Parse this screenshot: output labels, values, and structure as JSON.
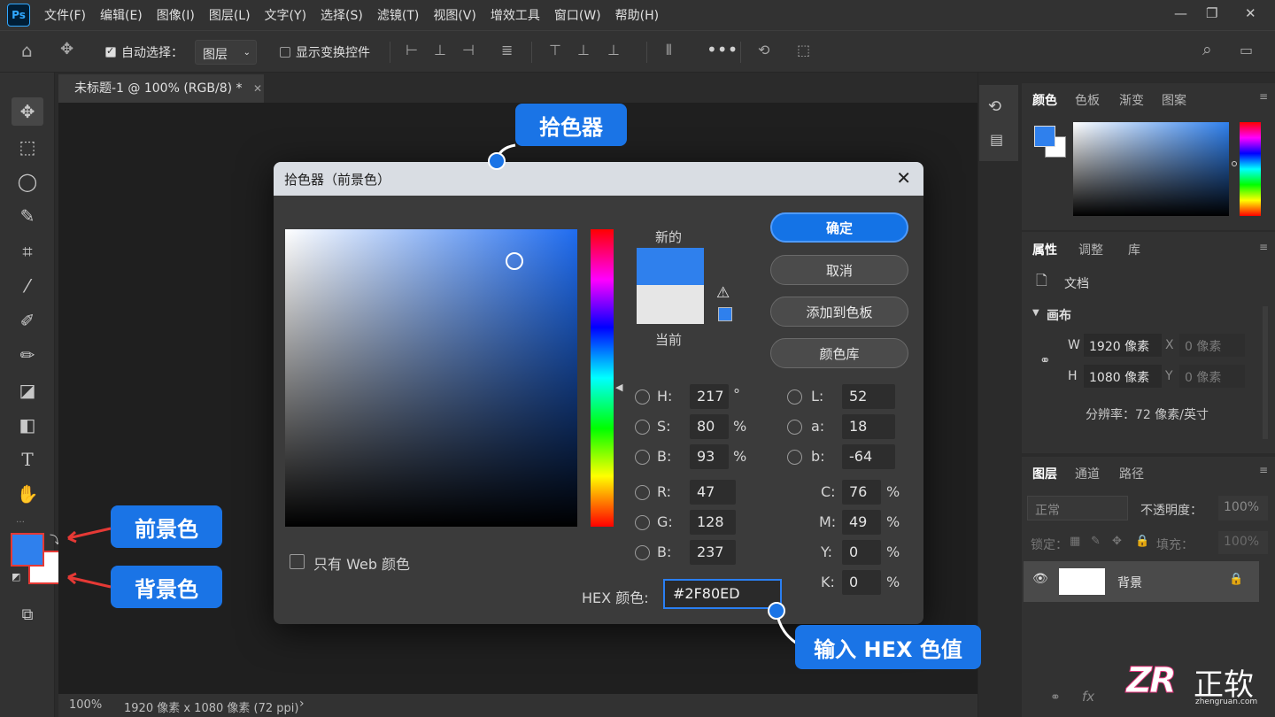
{
  "menu": {
    "logo": "Ps",
    "items": [
      "文件(F)",
      "编辑(E)",
      "图像(I)",
      "图层(L)",
      "文字(Y)",
      "选择(S)",
      "滤镜(T)",
      "视图(V)",
      "增效工具",
      "窗口(W)",
      "帮助(H)"
    ]
  },
  "options_bar": {
    "auto_select_label": "自动选择：",
    "auto_select_target": "图层",
    "show_transform_label": "显示变换控件"
  },
  "document": {
    "tab_title": "未标题-1 @ 100% (RGB/8) *",
    "zoom": "100%",
    "status": "1920 像素 x 1080 像素 (72 ppi)"
  },
  "color_panel": {
    "tabs": [
      "颜色",
      "色板",
      "渐变",
      "图案"
    ],
    "foreground": "#2F80ED",
    "background": "#FFFFFF"
  },
  "properties_panel": {
    "tabs": [
      "属性",
      "调整",
      "库"
    ],
    "doc_label": "文档",
    "section": "画布",
    "w_label": "W",
    "w_value": "1920 像素",
    "h_label": "H",
    "h_value": "1080 像素",
    "x_label": "X",
    "x_placeholder": "0 像素",
    "y_label": "Y",
    "y_placeholder": "0 像素",
    "resolution": "分辨率：72 像素/英寸"
  },
  "layers_panel": {
    "tabs": [
      "图层",
      "通道",
      "路径"
    ],
    "blend_mode": "正常",
    "opacity_label": "不透明度：",
    "opacity_value": "100%",
    "lock_label": "锁定：",
    "fill_label": "填充：",
    "fill_value": "100%",
    "layer_name": "背景"
  },
  "dialog": {
    "title": "拾色器（前景色）",
    "new_label": "新的",
    "current_label": "当前",
    "new_color": "#2F80ED",
    "current_color": "#E6E6E6",
    "buttons": {
      "ok": "确定",
      "cancel": "取消",
      "add_swatch": "添加到色板",
      "color_libraries": "颜色库"
    },
    "web_only_label": "只有 Web 颜色",
    "fields": {
      "H": "217",
      "H_unit": "°",
      "S": "80",
      "S_unit": "%",
      "Bhsb": "93",
      "Bhsb_unit": "%",
      "R": "47",
      "G": "128",
      "Brgb": "237",
      "L": "52",
      "a": "18",
      "b": "-64",
      "C": "76",
      "M": "49",
      "Y": "0",
      "K": "0",
      "cmyk_unit": "%"
    },
    "labels": {
      "H": "H:",
      "S": "S:",
      "Bhsb": "B:",
      "R": "R:",
      "G": "G:",
      "Brgb": "B:",
      "L": "L:",
      "a": "a:",
      "b": "b:",
      "C": "C:",
      "M": "M:",
      "Y": "Y:",
      "K": "K:"
    },
    "hex_label": "HEX 颜色:",
    "hex_value": "#2F80ED"
  },
  "callouts": {
    "picker": "拾色器",
    "foreground": "前景色",
    "background": "背景色",
    "hex": "输入 HEX 色值"
  },
  "watermark": {
    "logo_text": "ZR",
    "name": "正软",
    "url": "zhengruan.com"
  }
}
